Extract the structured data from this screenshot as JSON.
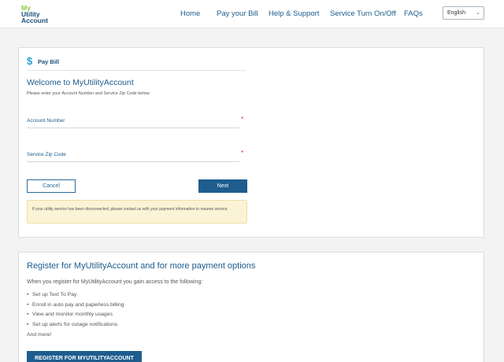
{
  "header": {
    "logo": {
      "line1": "My",
      "line2": "Utility",
      "line3": "Account"
    },
    "nav": [
      "Home",
      "Pay your Bill",
      "Help & Support",
      "Service Turn On/Off",
      "FAQs"
    ],
    "language": {
      "selected": "English"
    }
  },
  "pay_bill": {
    "section_title": "Pay Bill",
    "welcome_heading": "Welcome to MyUtilityAccount",
    "instructions": "Please enter your Account Number and Service Zip Code below.",
    "account_number": {
      "label": "Account Number",
      "required_mark": "*",
      "value": ""
    },
    "zip_code": {
      "label": "Service Zip Code",
      "required_mark": "*",
      "value": ""
    },
    "cancel_label": "Cancel",
    "next_label": "Next",
    "notice": "If your utility service has been disconnected, please contact us with your payment information to resume service."
  },
  "register": {
    "title": "Register for MyUtilityAccount and for more payment options",
    "intro": "When you register for MyUtilityAccount you gain access to the following:",
    "benefits": [
      "Set up Text To Pay",
      "Enroll in auto pay and paperless billing",
      "View and monitor monthly usages",
      "Set up alerts for outage notifications"
    ],
    "more": "And more!",
    "button_label": "REGISTER FOR MYUTILITYACCOUNT"
  }
}
